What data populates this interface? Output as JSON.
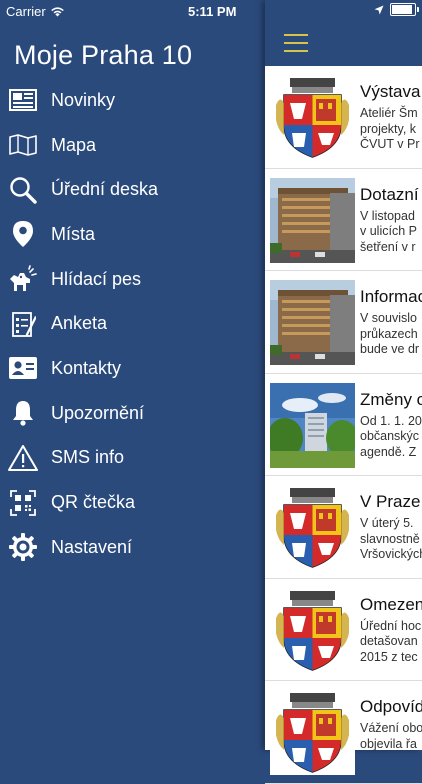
{
  "status_bar": {
    "carrier": "Carrier",
    "time": "5:11 PM"
  },
  "app_title": "Moje Praha 10",
  "menu": [
    {
      "label": "Novinky",
      "icon": "newspaper-icon"
    },
    {
      "label": "Mapa",
      "icon": "map-icon"
    },
    {
      "label": "Úřední deska",
      "icon": "search-icon"
    },
    {
      "label": "Místa",
      "icon": "location-pin-icon"
    },
    {
      "label": "Hlídací pes",
      "icon": "watchdog-icon"
    },
    {
      "label": "Anketa",
      "icon": "survey-icon"
    },
    {
      "label": "Kontakty",
      "icon": "contact-card-icon"
    },
    {
      "label": "Upozornění",
      "icon": "bell-icon"
    },
    {
      "label": "SMS info",
      "icon": "warning-icon"
    },
    {
      "label": "QR čtečka",
      "icon": "qr-code-icon"
    },
    {
      "label": "Nastavení",
      "icon": "gear-icon"
    }
  ],
  "news": [
    {
      "title": "Výstava",
      "text": "Ateliér Šm\nprojekty, k\nČVUT v Pr",
      "thumb": "coat-of-arms"
    },
    {
      "title": "Dotazní",
      "text": "V listopad\nv ulicích P\nšetření v r",
      "thumb": "building-photo"
    },
    {
      "title": "Informac",
      "text": "V souvislo\nprůkazech\nbude ve dr",
      "thumb": "building-photo"
    },
    {
      "title": "Změny o",
      "text": "Od 1. 1. 20\nobčanskýc\nagendě. Z",
      "thumb": "park-photo"
    },
    {
      "title": "V Praze",
      "text": "V úterý 5.\nslavnostně\nVršovických",
      "thumb": "coat-of-arms"
    },
    {
      "title": "Omezen",
      "text": "Úřední hoc\ndetašovan\n2015 z tec",
      "thumb": "coat-of-arms"
    },
    {
      "title": "Odpovíd",
      "text": "Vážení obo\nobjevila řa\n",
      "thumb": "coat-of-arms"
    }
  ],
  "colors": {
    "sidebar_bg": "#2b4a7c",
    "hamburger": "#d6c44a"
  }
}
